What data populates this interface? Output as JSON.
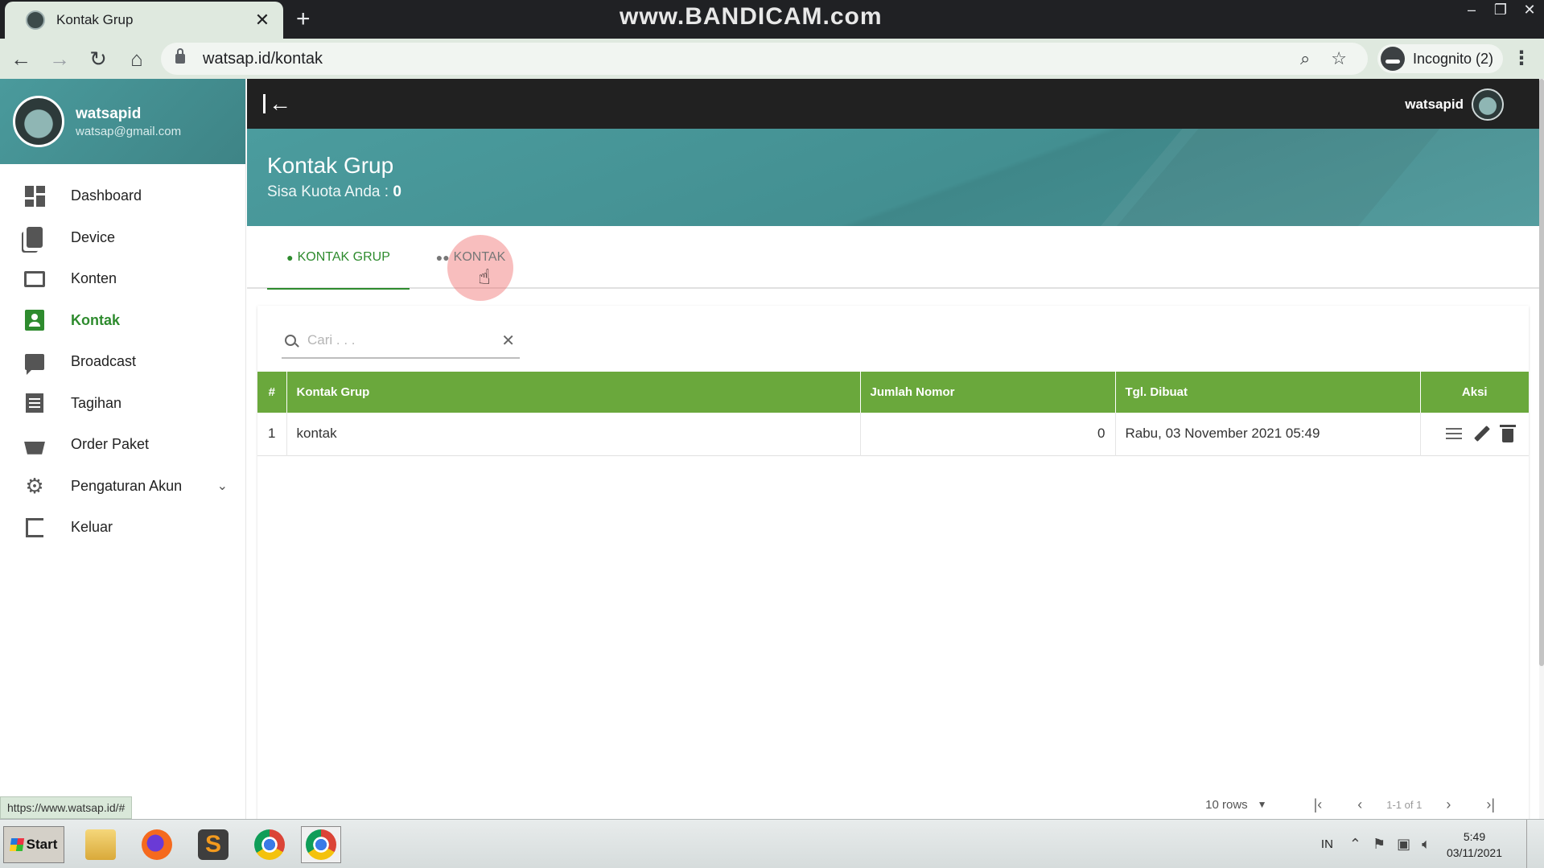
{
  "browser": {
    "tab_title": "Kontak Grup",
    "tab_close": "✕",
    "new_tab": "+",
    "watermark": "www.BANDICAM.com",
    "url": "watsap.id/kontak",
    "incognito_label": "Incognito (2)",
    "status_link": "https://www.watsap.id/#",
    "window_controls": [
      "–",
      "❐",
      "✕"
    ]
  },
  "sidebar": {
    "user_name": "watsapid",
    "user_email": "watsap@gmail.com",
    "items": [
      {
        "label": "Dashboard",
        "icon": "dashboard-icon"
      },
      {
        "label": "Device",
        "icon": "device-icon"
      },
      {
        "label": "Konten",
        "icon": "folder-icon"
      },
      {
        "label": "Kontak",
        "icon": "contact-icon",
        "active": true
      },
      {
        "label": "Broadcast",
        "icon": "chat-icon"
      },
      {
        "label": "Tagihan",
        "icon": "invoice-icon"
      },
      {
        "label": "Order Paket",
        "icon": "basket-icon"
      },
      {
        "label": "Pengaturan Akun",
        "icon": "gear-icon",
        "expandable": true
      },
      {
        "label": "Keluar",
        "icon": "logout-icon"
      }
    ]
  },
  "topbar": {
    "user_name": "watsapid"
  },
  "header": {
    "title": "Kontak Grup",
    "quota_label": "Sisa Kuota Anda :",
    "quota_value": "0"
  },
  "tabs": [
    {
      "label": "Kontak Grup",
      "icon": "person-icon",
      "active": true
    },
    {
      "label": "Kontak",
      "icon": "people-icon",
      "active": false
    }
  ],
  "search": {
    "placeholder": "Cari . . .",
    "value": ""
  },
  "table": {
    "columns": [
      "#",
      "Kontak Grup",
      "Jumlah Nomor",
      "Tgl. Dibuat",
      "Aksi"
    ],
    "rows": [
      {
        "no": "1",
        "name": "kontak",
        "count": "0",
        "created": "Rabu, 03 November 2021 05:49"
      }
    ]
  },
  "pagination": {
    "rows_per_page": "10 rows",
    "range": "1-1 of 1"
  },
  "taskbar": {
    "start_label": "Start",
    "language": "IN",
    "time": "5:49",
    "date": "03/11/2021"
  },
  "colors": {
    "accent_green": "#2e8b2e",
    "table_header": "#6aa83c",
    "header_teal": "#4b9c9e",
    "topbar_dark": "#212121"
  }
}
